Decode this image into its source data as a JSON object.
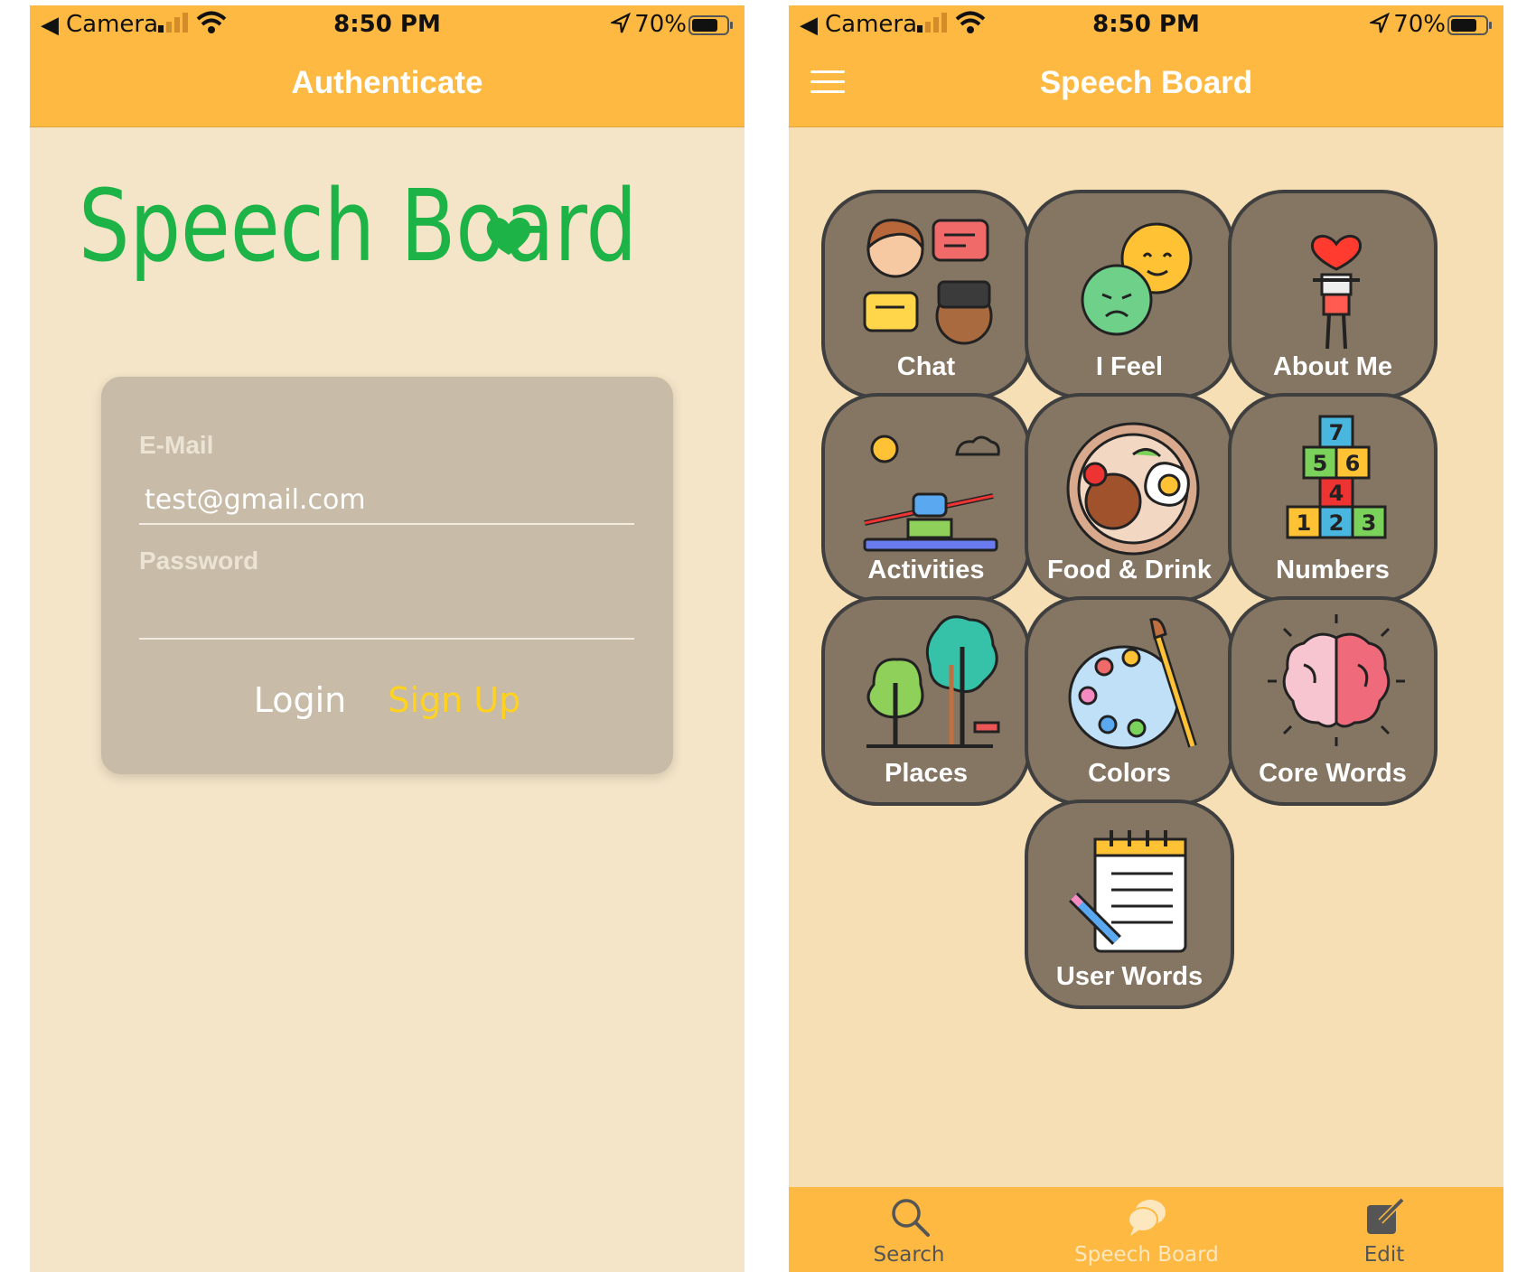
{
  "status_bar": {
    "back_glyph": "◀",
    "carrier": "Camera",
    "time": "8:50 PM",
    "battery": "70%"
  },
  "auth_screen": {
    "title": "Authenticate",
    "logo_text": "Speech Board",
    "email_label": "E-Mail",
    "email_value": "test@gmail.com",
    "password_label": "Password",
    "password_value": "",
    "login_label": "Login",
    "signup_label": "Sign Up",
    "colors": {
      "logo": "#1db346",
      "signup": "#ffd21f"
    }
  },
  "board_screen": {
    "title": "Speech Board",
    "categories": [
      {
        "label": "Chat",
        "icon": "chat-icon"
      },
      {
        "label": "I Feel",
        "icon": "feelings-icon"
      },
      {
        "label": "About Me",
        "icon": "person-heart-icon"
      },
      {
        "label": "Activities",
        "icon": "seesaw-icon"
      },
      {
        "label": "Food & Drink",
        "icon": "food-plate-icon"
      },
      {
        "label": "Numbers",
        "icon": "number-blocks-icon"
      },
      {
        "label": "Places",
        "icon": "trees-icon"
      },
      {
        "label": "Colors",
        "icon": "palette-icon"
      },
      {
        "label": "Core Words",
        "icon": "brain-icon"
      },
      {
        "label": "User Words",
        "icon": "notepad-icon"
      }
    ],
    "tab_bar": [
      {
        "label": "Search",
        "icon": "search-icon"
      },
      {
        "label": "Speech Board",
        "icon": "speech-bubble-icon",
        "active": true
      },
      {
        "label": "Edit",
        "icon": "edit-icon"
      }
    ]
  },
  "colors": {
    "header": "#fdb941",
    "tile": "#857563",
    "tile_border": "#3f3f3f"
  }
}
